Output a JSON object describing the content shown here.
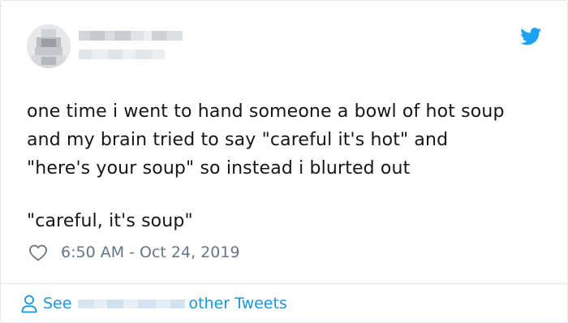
{
  "tweet": {
    "text_lines": [
      "one time i went to hand someone a bowl of hot soup",
      "and my brain tried to say \"careful it's hot\" and",
      "\"here's your soup\" so instead i blurted out"
    ],
    "punchline": "\"careful, it's soup\"",
    "timestamp": "6:50 AM - Oct 24, 2019"
  },
  "footer": {
    "see_label": "See",
    "other_tweets_label": "other Tweets"
  },
  "colors": {
    "text": "#14171a",
    "secondary": "#657786",
    "twitter_blue": "#1b95e0",
    "border": "#e1e8ed"
  },
  "icons": {
    "brand": "twitter-bird-icon",
    "like": "heart-icon",
    "profile": "person-icon"
  }
}
